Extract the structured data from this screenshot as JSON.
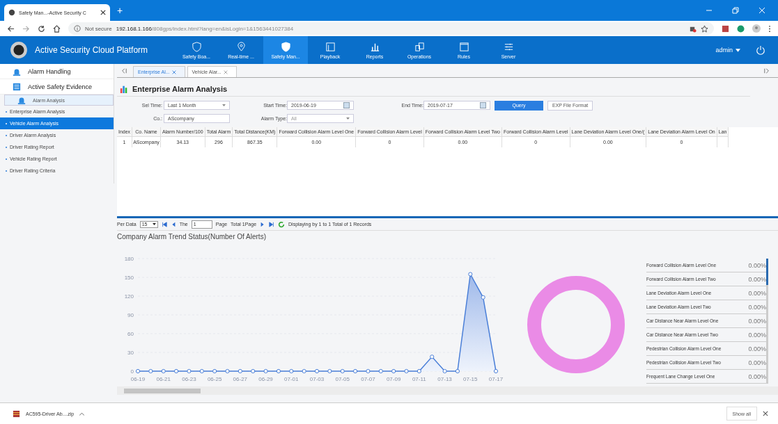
{
  "browser": {
    "tab_title": "Safety Man...-Active Security C",
    "new_tab": "+",
    "security": "Not secure",
    "url_host": "192.168.1.166",
    "url_path": "/808gps/index.html?lang=en&isLogin=1&1563441027384"
  },
  "app": {
    "title": "Active Security Cloud Platform",
    "user": "admin",
    "nav": [
      {
        "label": "Safety Boa...",
        "selected": false,
        "kind": "shield"
      },
      {
        "label": "Real-time ...",
        "selected": false,
        "kind": "pin"
      },
      {
        "label": "Safety Man...",
        "selected": true,
        "kind": "shield"
      },
      {
        "label": "Playback",
        "selected": false,
        "kind": "play"
      },
      {
        "label": "Reports",
        "selected": false,
        "kind": "bars"
      },
      {
        "label": "Operations",
        "selected": false,
        "kind": "ops"
      },
      {
        "label": "Rules",
        "selected": false,
        "kind": "window"
      },
      {
        "label": "Server",
        "selected": false,
        "kind": "sliders"
      }
    ]
  },
  "sidebar": {
    "groups": [
      {
        "label": "Alarm Handling",
        "kind": "siren",
        "expanded": false
      },
      {
        "label": "Active Safety Evidence",
        "kind": "doc",
        "expanded": false
      },
      {
        "label": "Alarm Analysis",
        "kind": "siren",
        "expanded": true
      }
    ],
    "items": [
      {
        "label": "Enterprise Alarm Analysis",
        "selected": false
      },
      {
        "label": "Vehicle Alarm Analysis",
        "selected": true
      },
      {
        "label": "Driver Alarm Analysis",
        "selected": false
      },
      {
        "label": "Driver Rating Report",
        "selected": false
      },
      {
        "label": "Vehicle Rating Report",
        "selected": false
      },
      {
        "label": "Driver Rating Criteria",
        "selected": false
      }
    ]
  },
  "page_tabs": [
    {
      "label": "Enterprise Al...",
      "selected": true
    },
    {
      "label": "Vehicle Alar...",
      "selected": false
    }
  ],
  "page_title": "Enterprise Alarm Analysis",
  "filters": {
    "sel_time_label": "Sel Time:",
    "sel_time": "Last 1 Month",
    "start_label": "Start Time:",
    "start": "2019-06-19",
    "end_label": "End Time:",
    "end": "2019-07-17",
    "query": "Query",
    "export": "EXP File Format",
    "co_label": "Co.:",
    "co": "AScompany",
    "type_label": "Alarm Type:",
    "type": "All"
  },
  "table": {
    "columns": [
      "Index",
      "Co. Name",
      "Alarm Number/100",
      "Total Alarm",
      "Total Distance(KM)",
      "Forward Collision Alarm Level One",
      "Forward Collision Alarm Level",
      "Forward Collision Alarm Level Two",
      "Forward Collision Alarm Level",
      "Lane Deviation Alarm Level One/(",
      "Lane Deviation Alarm Level On",
      "Lan"
    ],
    "rows": [
      [
        "1",
        "AScompany",
        "34.13",
        "296",
        "867.35",
        "0.00",
        "0",
        "0.00",
        "0",
        "0.00",
        "0",
        ""
      ]
    ]
  },
  "pager": {
    "per_label": "Per Data",
    "per": "15",
    "the": "The",
    "page": "1",
    "page_label": "Page",
    "total": "Total 1Page",
    "summary": "Displaying by 1 to 1 Total of 1 Records"
  },
  "chart_title": "Company Alarm Trend Status(Number Of Alerts)",
  "chart_data": {
    "type": "area",
    "categories": [
      "06-19",
      null,
      "06-21",
      null,
      "06-23",
      null,
      "06-25",
      null,
      "06-27",
      null,
      "06-29",
      null,
      "07-01",
      null,
      "07-03",
      null,
      "07-05",
      null,
      "07-07",
      null,
      "07-09",
      null,
      "07-11",
      null,
      "07-13",
      null,
      "07-15",
      null,
      "07-17"
    ],
    "grid": true,
    "series": [
      {
        "color": "#4a7fd8",
        "values": [
          0,
          0,
          0,
          0,
          0,
          0,
          0,
          0,
          0,
          0,
          0,
          0,
          0,
          0,
          0,
          0,
          0,
          0,
          0,
          0,
          0,
          0,
          0,
          23,
          0,
          0,
          155,
          118,
          0
        ]
      }
    ],
    "ylim": [
      0,
      180
    ],
    "yticks": [
      0,
      30,
      60,
      90,
      120,
      150,
      180
    ]
  },
  "legend": [
    {
      "label": "Forward Collision Alarm Level One",
      "value": "0.00%"
    },
    {
      "label": "Forward Collision Alarm Level Two",
      "value": "0.00%"
    },
    {
      "label": "Lane Deviation Alarm Level One",
      "value": "0.00%"
    },
    {
      "label": "Lane Deviation Alarm Level Two",
      "value": "0.00%"
    },
    {
      "label": "Car Distance Near Alarm Level One",
      "value": "0.00%"
    },
    {
      "label": "Car Distance Near Alarm Level Two",
      "value": "0.00%"
    },
    {
      "label": "Pedestrian Collision Alarm Level One",
      "value": "0.00%"
    },
    {
      "label": "Pedestrian Collision Alarm Level Two",
      "value": "0.00%"
    },
    {
      "label": "Frequent Lane Change Level One",
      "value": "0.00%"
    }
  ],
  "download": {
    "file": "AC595-Driver Ab....zip",
    "show_all": "Show all"
  }
}
